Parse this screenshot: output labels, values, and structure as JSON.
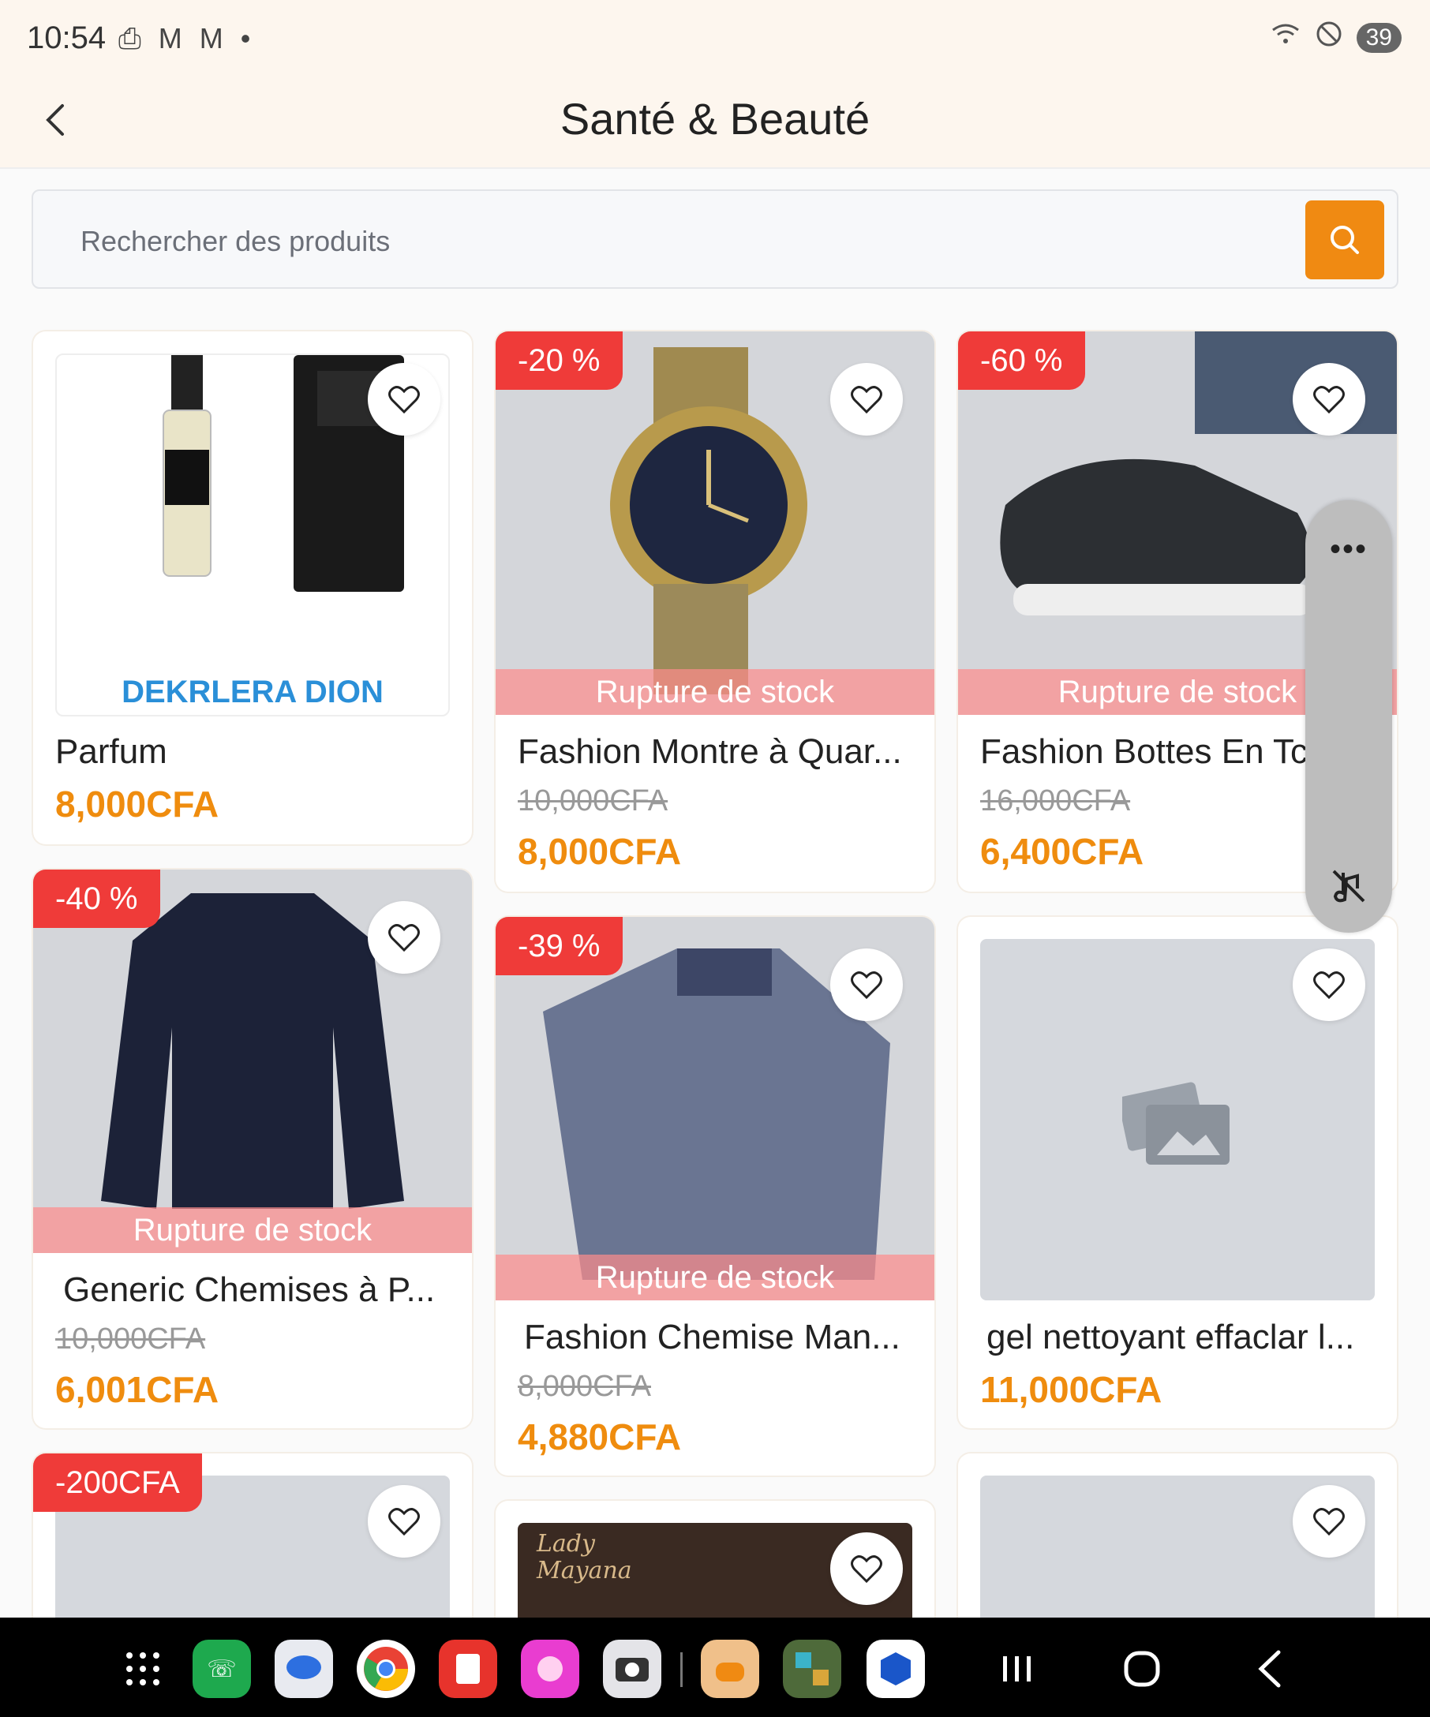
{
  "status_bar": {
    "time": "10:54",
    "left_icons": "⎙ M M •",
    "right_icons": "📶 ⊘",
    "battery": "39"
  },
  "header": {
    "title": "Santé & Beauté"
  },
  "search": {
    "placeholder": "Rechercher des produits"
  },
  "products": [
    {
      "name": "Parfum",
      "price": "8,000CFA",
      "brand_text": "DEKRLERA DION"
    },
    {
      "discount": "-20 %",
      "stock_status": "Rupture de stock",
      "name": "Fashion Montre à Quar...",
      "old_price": "10,000CFA",
      "price": "8,000CFA"
    },
    {
      "discount": "-60 %",
      "stock_status": "Rupture de stock",
      "name": "Fashion Bottes En Tc",
      "old_price": "16,000CFA",
      "price": "6,400CFA"
    },
    {
      "discount": "-40 %",
      "stock_status": "Rupture de stock",
      "name": "Generic Chemises à P...",
      "old_price": "10,000CFA",
      "price": "6,001CFA"
    },
    {
      "discount": "-39 %",
      "stock_status": "Rupture de stock",
      "name": "Fashion Chemise Man...",
      "old_price": "8,000CFA",
      "price": "4,880CFA"
    },
    {
      "name": "gel nettoyant effaclar l...",
      "price": "11,000CFA"
    },
    {
      "discount": "-200CFA"
    },
    {
      "image_text": "Lady Mayana"
    },
    {}
  ],
  "float_panel": {
    "more": "•••"
  },
  "colors": {
    "accent": "#f08a12",
    "price": "#ef8c0e",
    "discount": "#ef3b39",
    "header_bg": "#fdf6ee"
  },
  "nav_apps": [
    "apps-grid-icon",
    "phone-icon",
    "messages-icon",
    "chrome-icon",
    "notes-icon",
    "gallery-icon",
    "camera-icon",
    "shop-app-icon",
    "game-app-icon",
    "store-app-icon"
  ]
}
